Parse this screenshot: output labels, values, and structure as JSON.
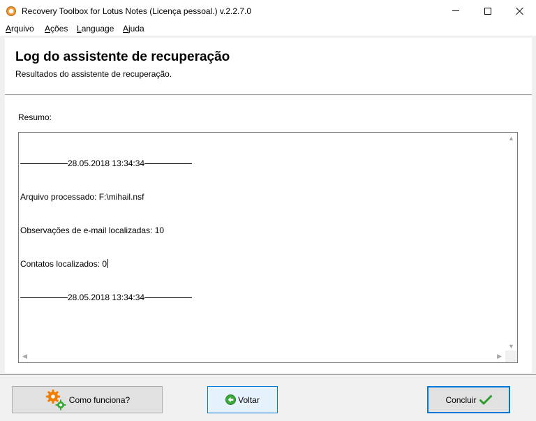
{
  "window": {
    "title": "Recovery Toolbox for Lotus Notes (Licença pessoal.) v.2.2.7.0",
    "icon": "app-logo-icon",
    "controls": [
      "minimize-icon",
      "maximize-icon",
      "close-icon"
    ]
  },
  "menu": {
    "items": [
      "Arquivo",
      "Ações",
      "Language",
      "Ajuda"
    ]
  },
  "header": {
    "title": "Log do assistente de recuperação",
    "subtitle": "Resultados do assistente de recuperação."
  },
  "summary": {
    "label": "Resumo:",
    "log": {
      "separator_timestamp": "28.05.2018 13:34:34",
      "line_file": "Arquivo processado: F:\\mihail.nsf",
      "line_notes": "Observações de e-mail localizadas: 10",
      "line_contacts": "Contatos localizados: 0"
    }
  },
  "buttons": {
    "how_it_works": "Como funciona?",
    "back": "Voltar",
    "finish": "Concluir"
  },
  "icons": {
    "how_it_works": "gears-icon",
    "back": "back-arrow-icon",
    "finish": "checkmark-icon"
  },
  "colors": {
    "accent_border": "#0078d7",
    "gear_orange": "#f07d00",
    "gear_green": "#3aa83a",
    "check_green": "#2e9b2e"
  }
}
